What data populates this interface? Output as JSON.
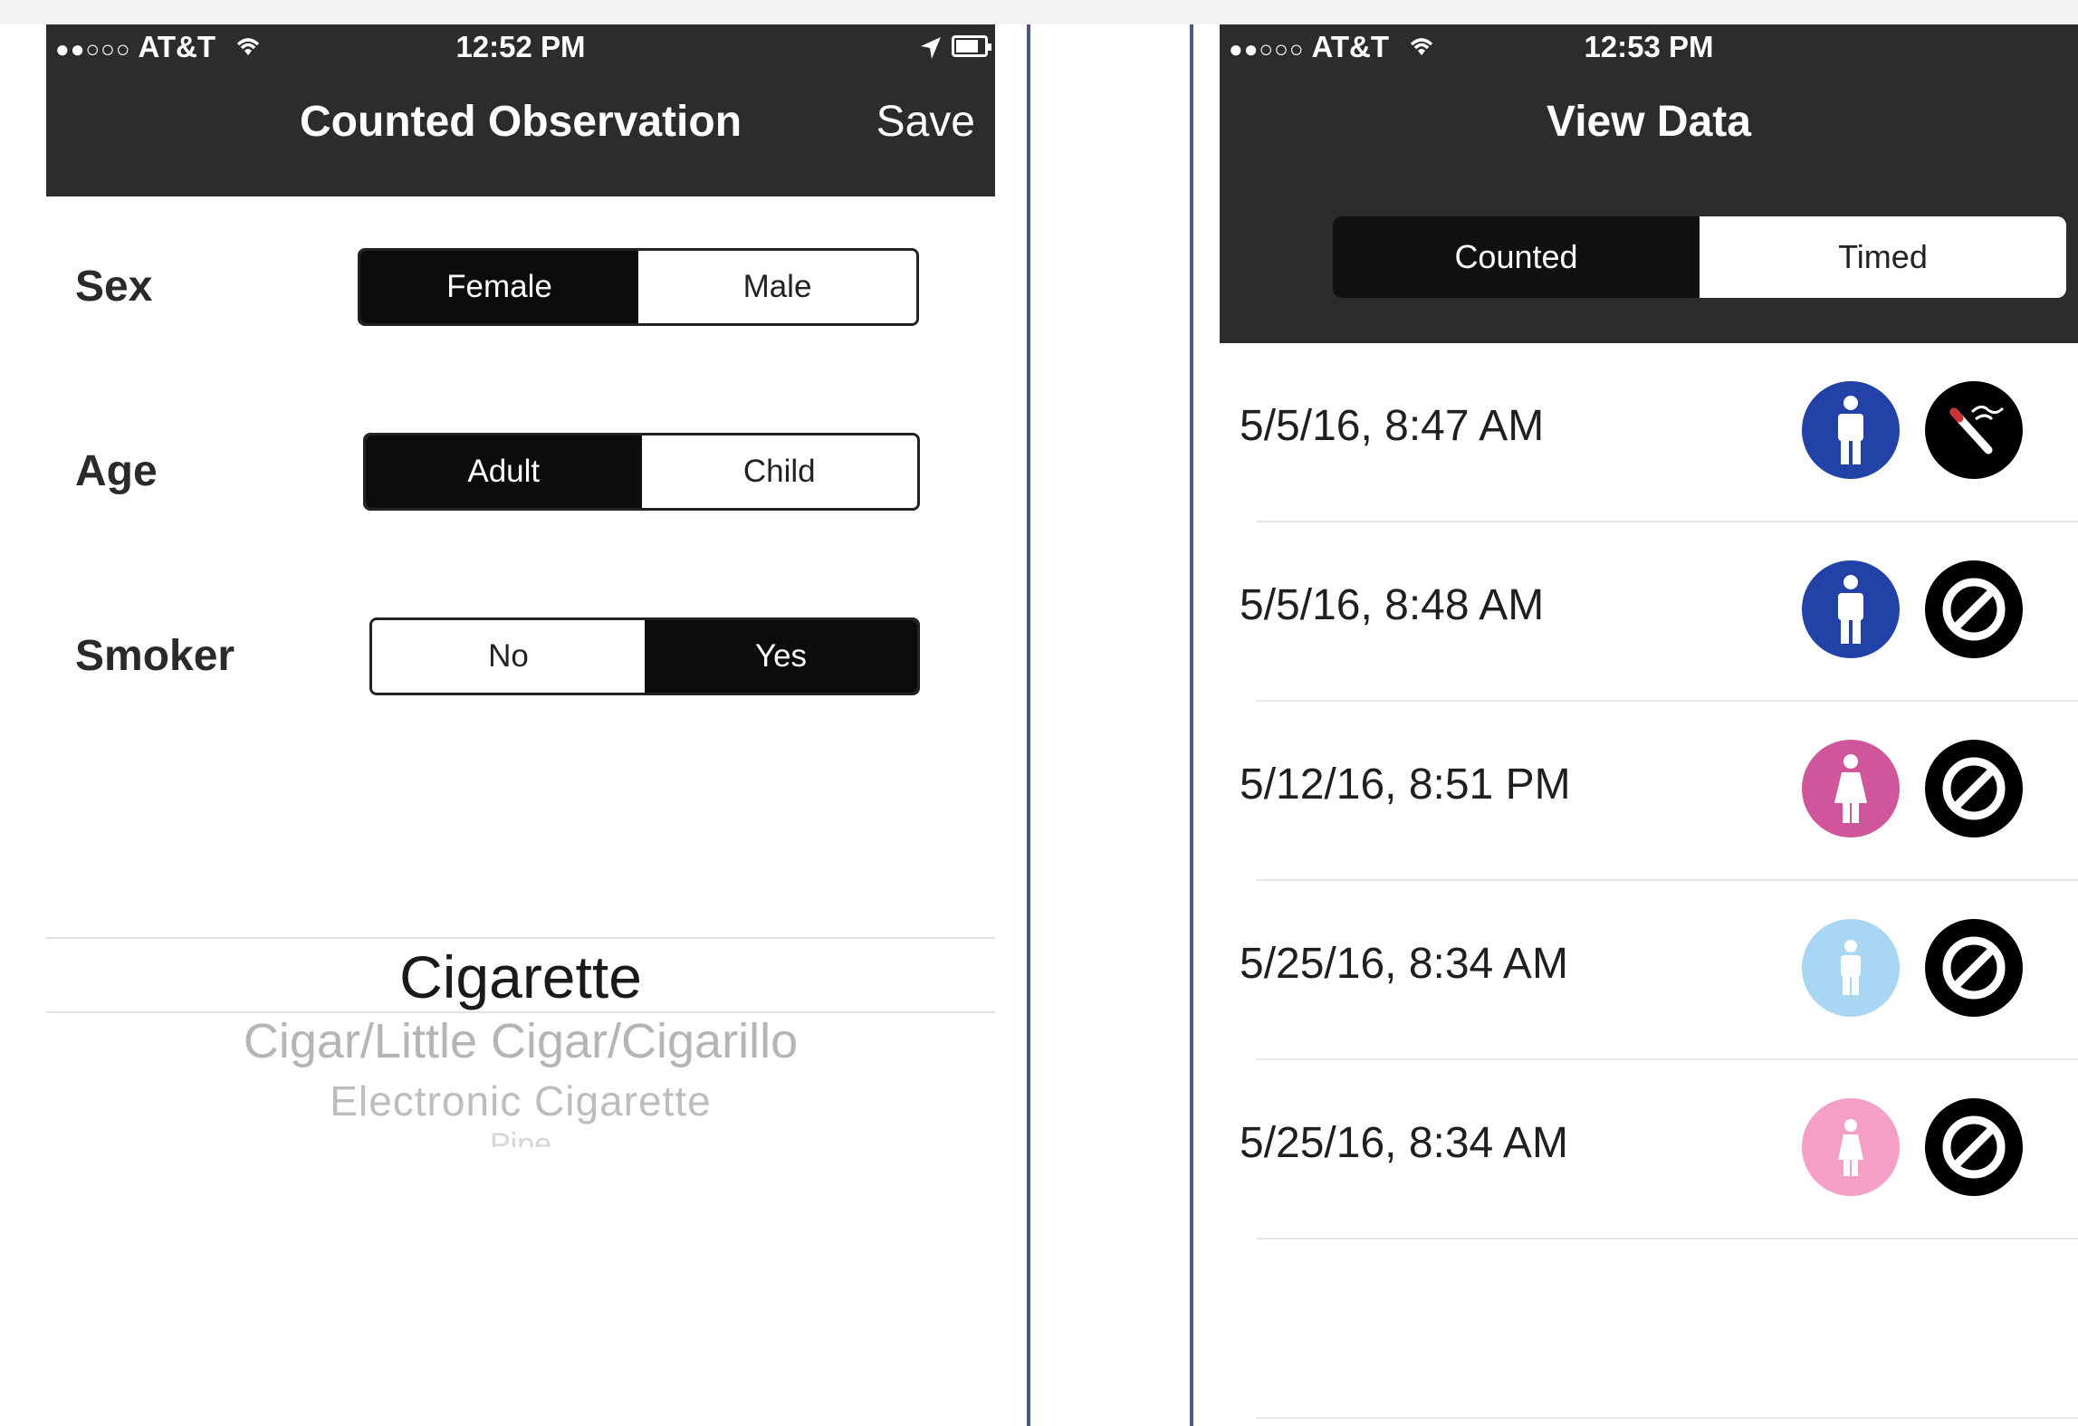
{
  "left": {
    "status": {
      "carrier": "AT&T",
      "time": "12:52 PM"
    },
    "nav": {
      "title": "Counted Observation",
      "save_label": "Save"
    },
    "fields": [
      {
        "label": "Sex",
        "options": [
          "Female",
          "Male"
        ],
        "selected": 0
      },
      {
        "label": "Age",
        "options": [
          "Adult",
          "Child"
        ],
        "selected": 0
      },
      {
        "label": "Smoker",
        "options": [
          "No",
          "Yes"
        ],
        "selected": 1
      }
    ],
    "picker": {
      "selected": "Cigarette",
      "items": [
        "Cigar/Little Cigar/Cigarillo",
        "Electronic Cigarette",
        "Pipe"
      ]
    }
  },
  "right": {
    "status": {
      "carrier": "AT&T",
      "time": "12:53 PM"
    },
    "nav": {
      "title": "View Data"
    },
    "tabs": [
      {
        "label": "Counted",
        "active": true
      },
      {
        "label": "Timed",
        "active": false
      }
    ],
    "rows": [
      {
        "datetime": "5/5/16, 8:47 AM",
        "sex_icon": "male-icon",
        "sex_color": "#2342a8",
        "status_icon": "cigarette-icon"
      },
      {
        "datetime": "5/5/16, 8:48 AM",
        "sex_icon": "male-icon",
        "sex_color": "#2342a8",
        "status_icon": "no-smoking-icon"
      },
      {
        "datetime": "5/12/16, 8:51 PM",
        "sex_icon": "female-icon",
        "sex_color": "#d0569b",
        "status_icon": "no-smoking-icon"
      },
      {
        "datetime": "5/25/16, 8:34 AM",
        "sex_icon": "male-icon",
        "sex_color": "#a9d6f2",
        "status_icon": "no-smoking-icon"
      },
      {
        "datetime": "5/25/16, 8:34 AM",
        "sex_icon": "female-icon",
        "sex_color": "#f4a0c6",
        "status_icon": "no-smoking-icon"
      }
    ]
  }
}
